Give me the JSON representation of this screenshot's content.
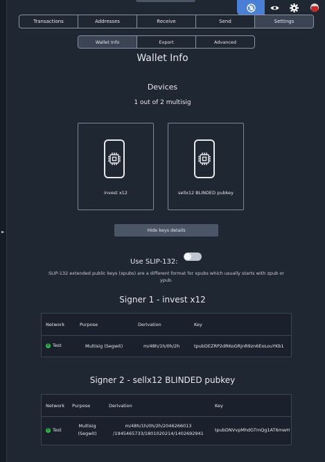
{
  "nav": {
    "tabs": [
      "Transactions",
      "Addresses",
      "Receive",
      "Send",
      "Settings"
    ],
    "active": "Settings"
  },
  "subnav": {
    "tabs": [
      "Wallet Info",
      "Export",
      "Advanced"
    ],
    "active": "Wallet Info"
  },
  "topbar": {
    "icons": [
      "hide-balance-icon",
      "eye-icon",
      "gear-icon",
      "avatar-icon"
    ],
    "accent": "#4a7fd6"
  },
  "page": {
    "title": "Wallet Info",
    "devices_heading": "Devices",
    "multisig_text": "1 out of 2 multisig"
  },
  "devices": [
    {
      "label": "invest x12",
      "icon": "device-chip-icon"
    },
    {
      "label": "sellx12 BLINDED pubkey",
      "icon": "device-chip-icon"
    }
  ],
  "hide_keys_button": "Hide keys details",
  "slip": {
    "label": "Use SLIP-132:",
    "enabled": false,
    "description": "SLIP-132 extended public keys (xpubs) are a different format for xpubs which usually starts with zpub or ypub."
  },
  "signers": [
    {
      "title": "Signer 1 - invest x12",
      "columns": [
        "Network",
        "Purpose",
        "Derivation",
        "Key"
      ],
      "row": {
        "network": "Test",
        "network_badge": "₿",
        "purpose": "Multisig (Segwit)",
        "derivation": "m/48h/1h/0h/2h",
        "key": "tpubDEZRP2dRKoGRjnR9zn6EoLouYKb1"
      }
    },
    {
      "title": "Signer 2 - sellx12 BLINDED pubkey",
      "columns": [
        "Network",
        "Purpose",
        "Derivation",
        "Key"
      ],
      "row": {
        "network": "Test",
        "network_badge": "₿",
        "purpose_line1": "Multisig",
        "purpose_line2": "(Segwit)",
        "derivation_line1": "m/48h/1h/0h/2h/2046266013",
        "derivation_line2": "/1945465733/1801020214/1402692941",
        "key": "tpubDNVvpMhdGTmQg1AT6mwH"
      }
    }
  ]
}
